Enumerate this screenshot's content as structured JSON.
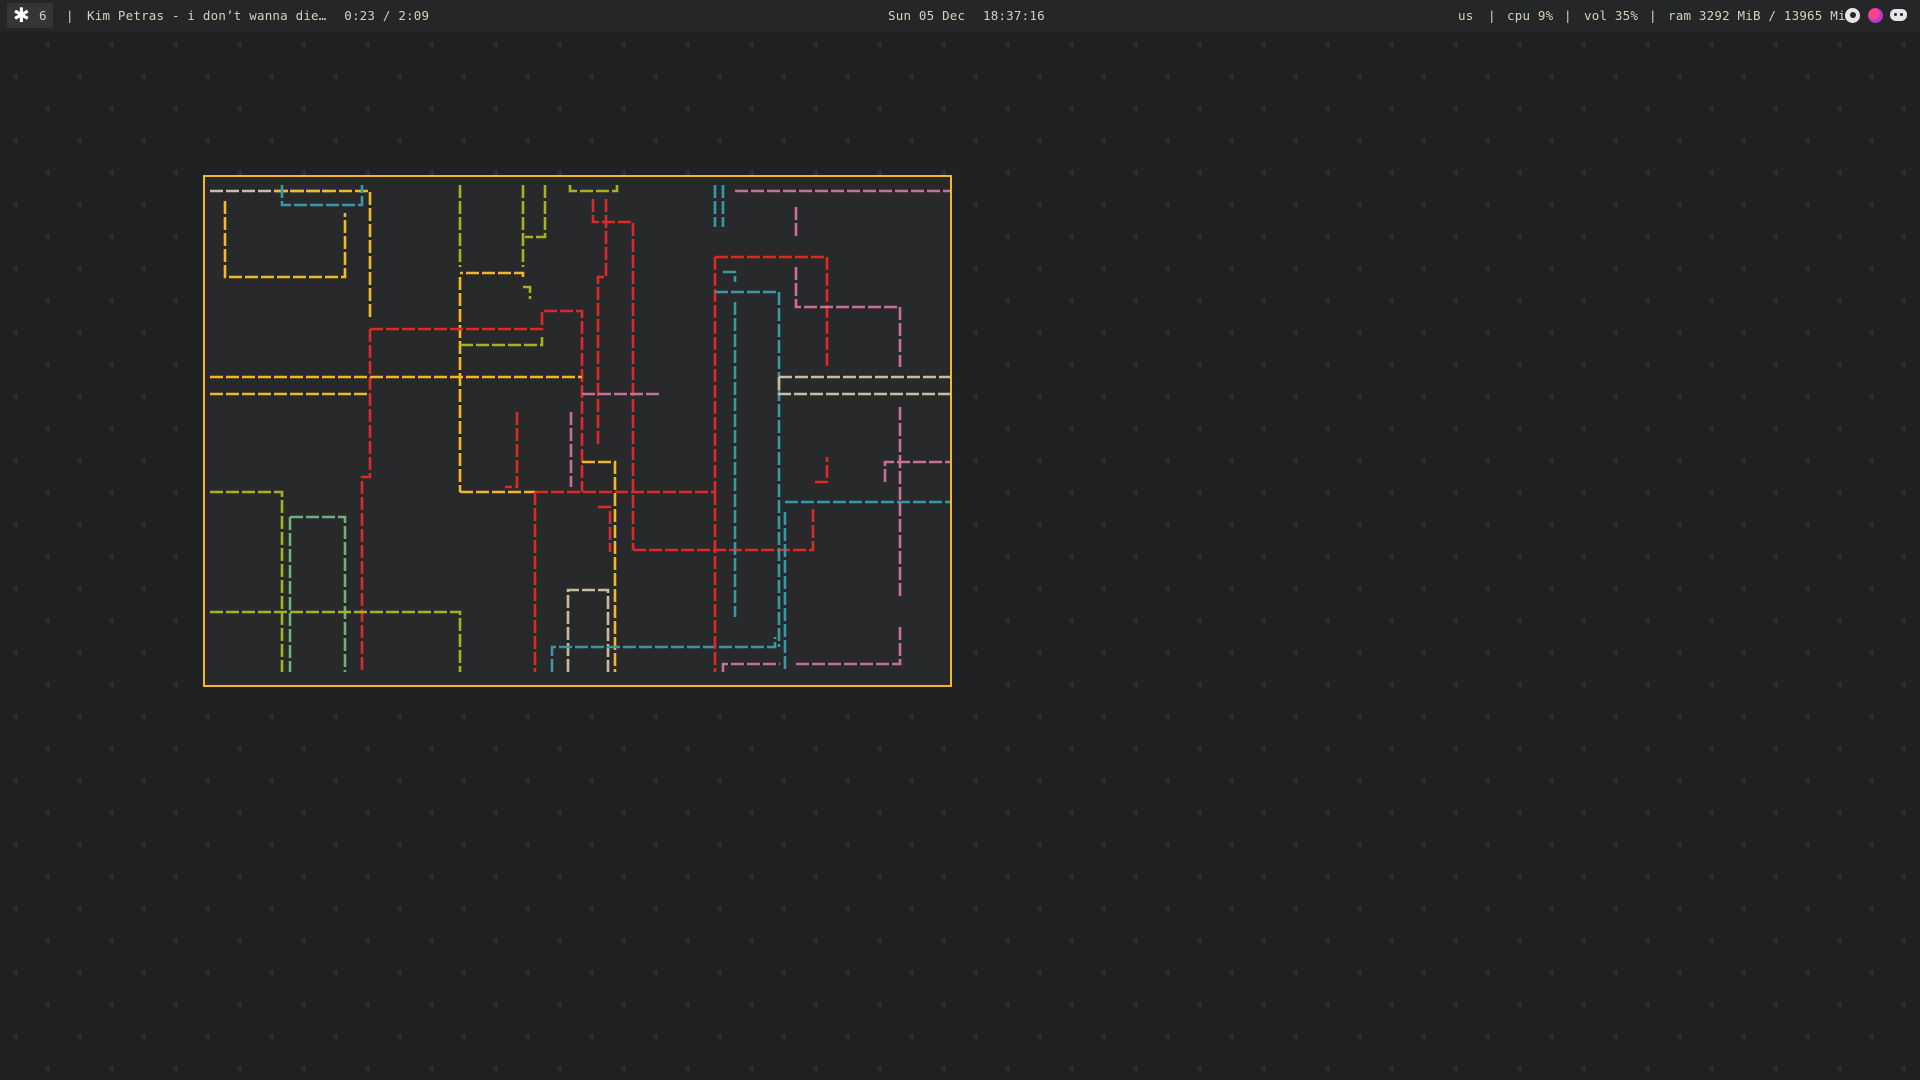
{
  "statusbar": {
    "workspace_icon": "asterisk-icon",
    "workspace_number": "6",
    "separator": "|",
    "now_playing": "Kim Petras - i don’t wanna die…",
    "track_time": "0:23 / 2:09",
    "date": "Sun 05 Dec",
    "time": "18:37:16",
    "keyboard_layout": "us",
    "cpu": "cpu 9%",
    "volume": "vol 35%",
    "ram": "ram 3292 MiB / 13965 MiB",
    "tray_icons": [
      "steam-icon",
      "firefox-icon",
      "discord-icon"
    ]
  },
  "wallpaper": {
    "glyph": "ᵕ̈",
    "background": "#1f2122",
    "glyph_color": "#5c5f5c"
  },
  "terminal": {
    "program": "pipes",
    "border_color": "#f4b62a",
    "pipe_colors": {
      "yellow": "#f4b62a",
      "olive": "#a9b122",
      "red": "#dd2a26",
      "teal": "#3a97a6",
      "green": "#6fb07f",
      "pink": "#c86f9c",
      "beige": "#c9bca0"
    }
  }
}
